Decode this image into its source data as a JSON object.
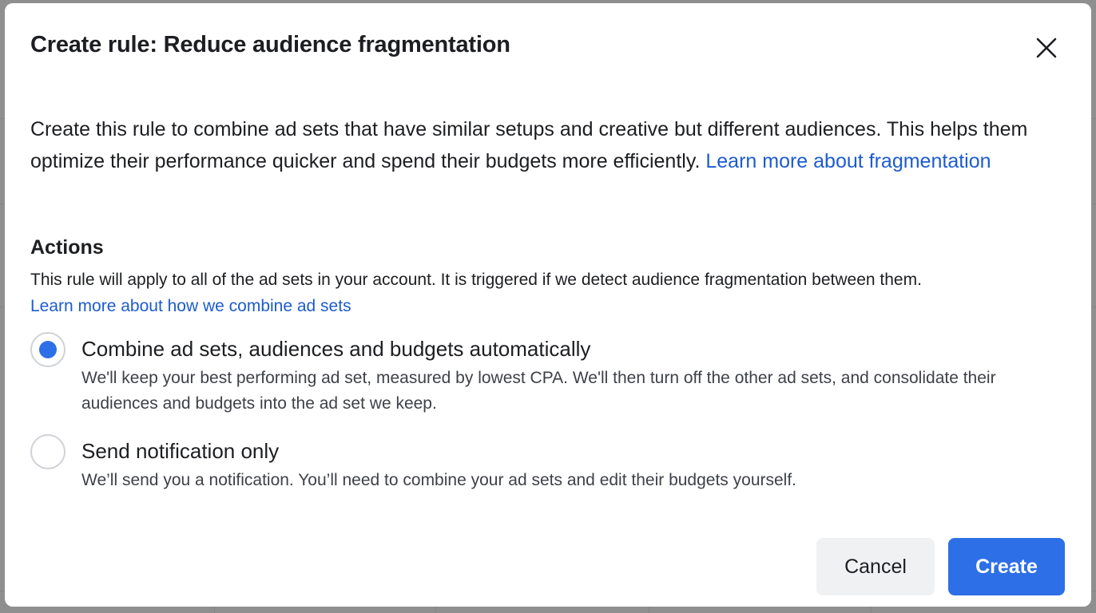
{
  "dialog": {
    "title": "Create rule: Reduce audience fragmentation",
    "close_icon": "close-icon",
    "description": {
      "text": "Create this rule to combine ad sets that have similar setups and creative but different audiences. This helps them optimize their performance quicker and spend their budgets more efficiently. ",
      "link": "Learn more about fragmentation"
    },
    "actions": {
      "heading": "Actions",
      "description": "This rule will apply to all of the ad sets in your account. It is triggered if we detect audience fragmentation between them.",
      "link": "Learn more about how we combine ad sets",
      "options": [
        {
          "label": "Combine ad sets, audiences and budgets automatically",
          "description": "We'll keep your best performing ad set, measured by lowest CPA. We'll then turn off the other ad sets, and consolidate their audiences and budgets into the ad set we keep.",
          "selected": true
        },
        {
          "label": "Send notification only",
          "description": "We’ll send you a notification. You’ll need to combine your ad sets and edit their budgets yourself.",
          "selected": false
        }
      ]
    },
    "buttons": {
      "cancel": "Cancel",
      "create": "Create"
    },
    "colors": {
      "primary": "#2d6fe6",
      "link": "#1d5bd0",
      "text": "#1c1e21"
    }
  }
}
